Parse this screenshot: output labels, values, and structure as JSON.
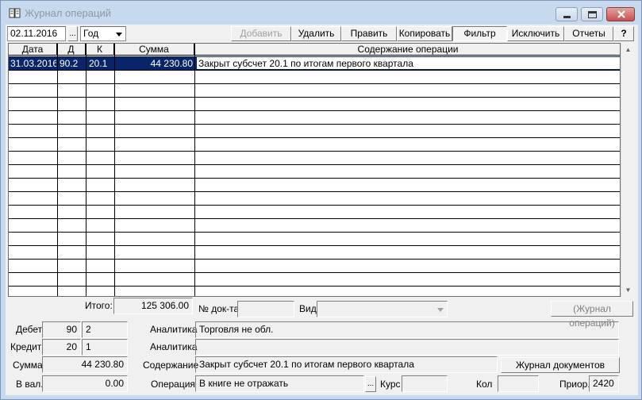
{
  "window": {
    "title": "Журнал операций"
  },
  "toolbar": {
    "date_value": "02.11.2016",
    "browse_label": "...",
    "period_value": "Год",
    "buttons": {
      "add": "Добавить",
      "delete": "Удалить",
      "edit": "Править",
      "copy": "Копировать",
      "filter": "Фильтр",
      "exclude": "Исключить",
      "reports": "Отчеты",
      "help": "?"
    }
  },
  "table": {
    "columns": [
      "Дата",
      "Д",
      "К",
      "Сумма",
      "Содержание операции"
    ],
    "rows": [
      {
        "date": "31.03.2016",
        "debit": "90.2",
        "credit": "20.1",
        "amount": "44 230.80",
        "content": "Закрыт субсчет 20.1 по итогам первого квартала",
        "selected": true
      }
    ]
  },
  "summary": {
    "total_label": "Итого:",
    "total_value": "125 306.00",
    "doc_no_label": "№ док-та",
    "doc_no_value": "",
    "kind_label": "Вид",
    "kind_value": "",
    "journal_ops_button": "(Журнал операций)"
  },
  "details": {
    "debit_label": "Дебет",
    "debit_account": "90",
    "debit_sub": "2",
    "credit_label": "Кредит",
    "credit_account": "20",
    "credit_sub": "1",
    "sum_label": "Сумма",
    "sum_value": "44 230.80",
    "foreign_label": "В вал.",
    "foreign_value": "0.00",
    "analytics_label_1": "Аналитика",
    "analytics_value_1": "Торговля не обл.",
    "analytics_label_2": "Аналитика",
    "analytics_value_2": "",
    "content_label": "Содержание",
    "content_value": "Закрыт субсчет 20.1 по итогам первого квартала",
    "journal_docs_button": "Журнал документов",
    "operation_label": "Операция",
    "operation_value": "В книге не отражать",
    "operation_browse": "...",
    "rate_label": "Курс",
    "rate_value": "",
    "qty_label": "Кол",
    "qty_value": "",
    "priority_label": "Приор.",
    "priority_value": "2420"
  },
  "colors": {
    "selection": "#0a246a",
    "window_frame": "#c7d9ee",
    "close_button": "#c75050"
  }
}
